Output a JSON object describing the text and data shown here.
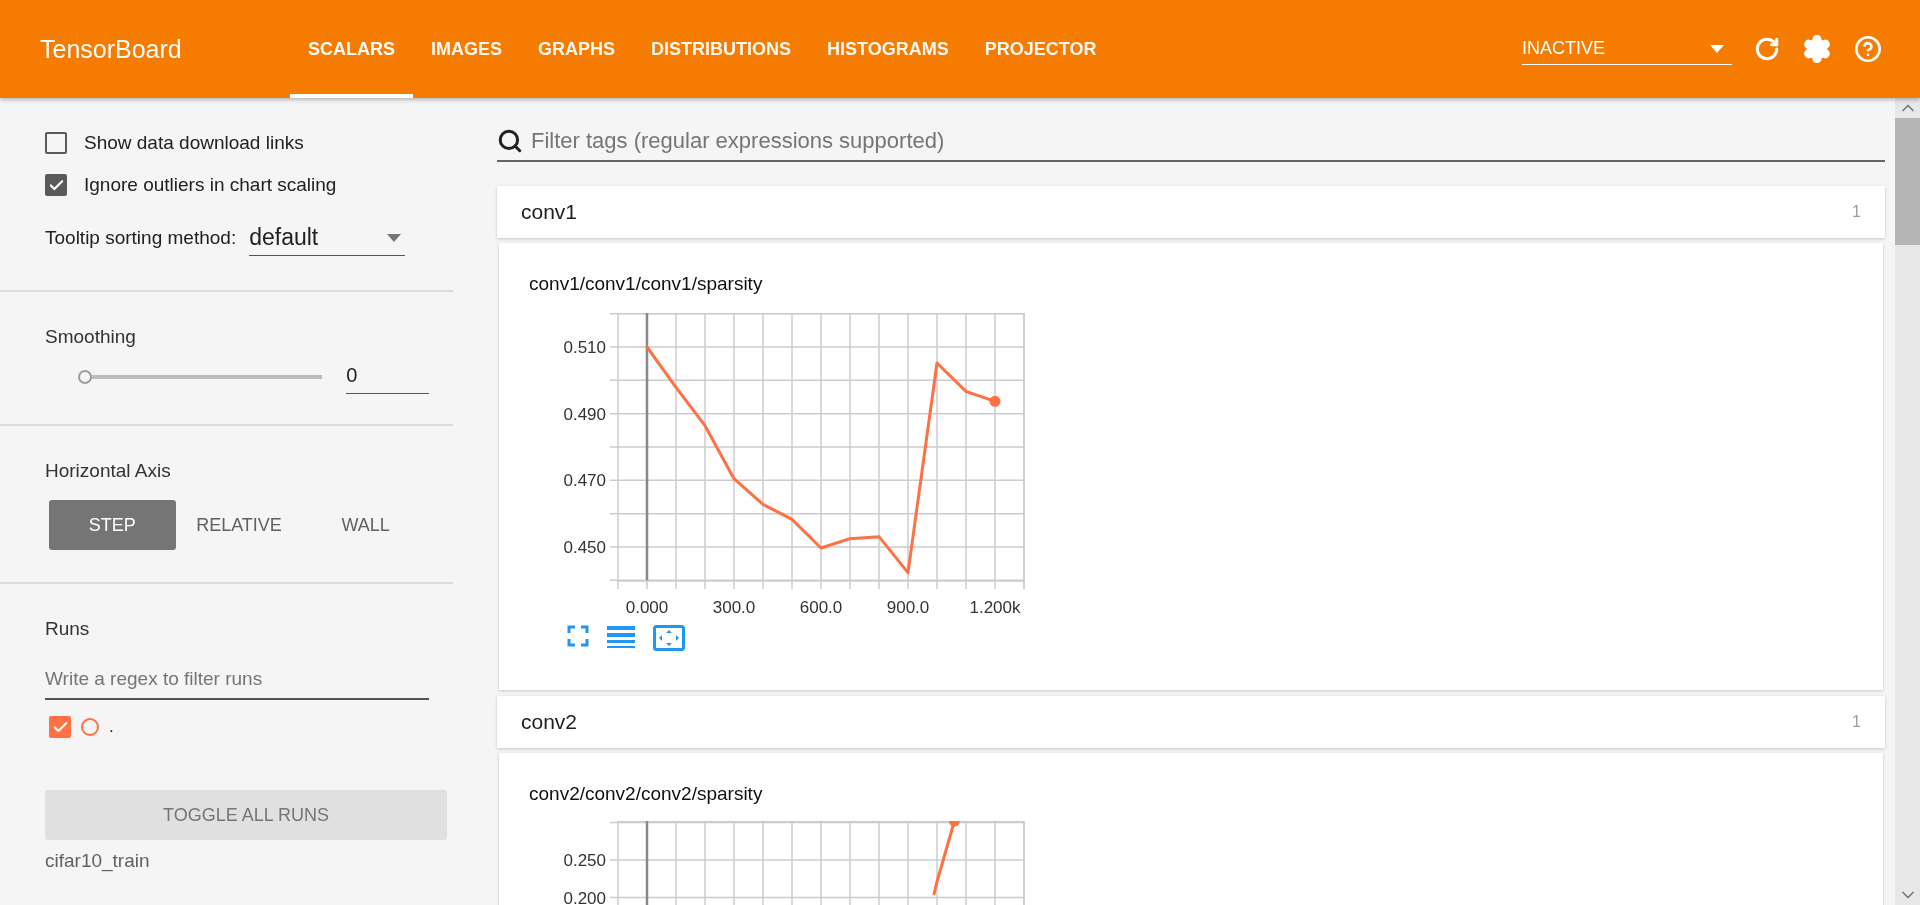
{
  "header": {
    "title": "TensorBoard",
    "tabs": [
      {
        "label": "SCALARS",
        "selected": true
      },
      {
        "label": "IMAGES",
        "selected": false
      },
      {
        "label": "GRAPHS",
        "selected": false
      },
      {
        "label": "DISTRIBUTIONS",
        "selected": false
      },
      {
        "label": "HISTOGRAMS",
        "selected": false
      },
      {
        "label": "PROJECTOR",
        "selected": false
      }
    ],
    "status_select": {
      "value": "INACTIVE"
    }
  },
  "sidebar": {
    "options": [
      {
        "label": "Show data download links",
        "checked": false
      },
      {
        "label": "Ignore outliers in chart scaling",
        "checked": true
      }
    ],
    "tooltip_sorting": {
      "label": "Tooltip sorting method:",
      "value": "default"
    },
    "smoothing": {
      "label": "Smoothing",
      "level": 0,
      "value": "0"
    },
    "horizontal_axis": {
      "label": "Horizontal Axis",
      "options": [
        {
          "label": "STEP",
          "selected": true
        },
        {
          "label": "RELATIVE",
          "selected": false
        },
        {
          "label": "WALL",
          "selected": false
        }
      ]
    },
    "runs": {
      "label": "Runs",
      "placeholder": "Write a regex to filter runs",
      "items": [
        {
          "label": ".",
          "checked": true,
          "color": "#ff7043"
        }
      ],
      "toggle_button": "TOGGLE ALL RUNS",
      "footer": "cifar10_train"
    }
  },
  "main": {
    "filter": {
      "placeholder": "Filter tags (regular expressions supported)"
    },
    "groups": [
      {
        "name": "conv1",
        "count": "1",
        "charts": [
          {
            "title": "conv1/conv1/conv1/sparsity",
            "chart_data": {
              "type": "line",
              "x": [
                0,
                100,
                200,
                300,
                400,
                500,
                600,
                700,
                800,
                900,
                1000,
                1100,
                1200
              ],
              "grid": true,
              "series": [
                {
                  "color": "#ff7043",
                  "values": [
                    0.51,
                    0.4979,
                    0.4864,
                    0.4705,
                    0.4628,
                    0.4583,
                    0.4497,
                    0.4525,
                    0.4531,
                    0.4423,
                    0.5052,
                    0.4967,
                    0.4937
                  ]
                }
              ],
              "xlim": [
                -100,
                1300
              ],
              "ylim": [
                0.4398,
                0.5202
              ],
              "xticks": [
                {
                  "value": 0,
                  "label": "0.000"
                },
                {
                  "value": 300,
                  "label": "300.0"
                },
                {
                  "value": 600,
                  "label": "600.0"
                },
                {
                  "value": 900,
                  "label": "900.0"
                },
                {
                  "value": 1200,
                  "label": "1.200k"
                }
              ],
              "yticks": [
                {
                  "value": 0.45,
                  "label": "0.450"
                },
                {
                  "value": 0.47,
                  "label": "0.470"
                },
                {
                  "value": 0.49,
                  "label": "0.490"
                },
                {
                  "value": 0.51,
                  "label": "0.510"
                }
              ]
            }
          }
        ]
      },
      {
        "name": "conv2",
        "count": "1",
        "charts": [
          {
            "title": "conv2/conv2/conv2/sparsity",
            "chart_data": {
              "type": "line",
              "x": [
                990,
                1000,
                1060
              ],
              "grid": true,
              "series": [
                {
                  "color": "#ff7043",
                  "values": [
                    0.205,
                    0.221,
                    0.302
                  ]
                }
              ],
              "xlim": [
                -100,
                1300
              ],
              "ylim": [
                0.19,
                0.302
              ],
              "yticks": [
                {
                  "value": 0.2,
                  "label": "0.200"
                },
                {
                  "value": 0.25,
                  "label": "0.250"
                }
              ]
            }
          }
        ]
      }
    ]
  }
}
